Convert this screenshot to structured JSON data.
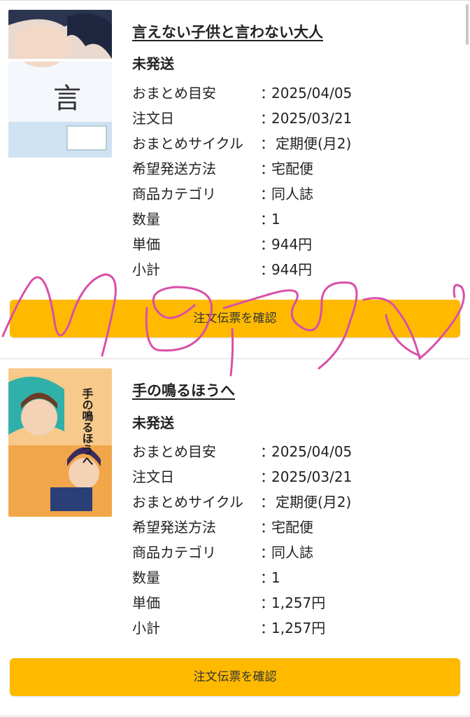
{
  "orders": [
    {
      "title": "言えない子供と言わない大人",
      "status": "未発送",
      "cover_text": "言",
      "rows": [
        {
          "label": "おまとめ目安",
          "colon": "：",
          "value": "2025/04/05"
        },
        {
          "label": "注文日",
          "colon": "：",
          "value": "2025/03/21"
        },
        {
          "label": "おまとめサイクル",
          "colon": "：",
          "value": "定期便(月2)"
        },
        {
          "label": "希望発送方法",
          "colon": "：",
          "value": "宅配便"
        },
        {
          "label": "商品カテゴリ",
          "colon": "：",
          "value": "同人誌"
        },
        {
          "label": "数量",
          "colon": "：",
          "value": "1"
        },
        {
          "label": "単価",
          "colon": "：",
          "value": "944円"
        },
        {
          "label": "小計",
          "colon": "：",
          "value": "944円"
        }
      ],
      "button_label": "注文伝票を確認"
    },
    {
      "title": "手の鳴るほうへ",
      "status": "未発送",
      "cover_text": "手の鳴るほうへ",
      "rows": [
        {
          "label": "おまとめ目安",
          "colon": "：",
          "value": "2025/04/05"
        },
        {
          "label": "注文日",
          "colon": "：",
          "value": "2025/03/21"
        },
        {
          "label": "おまとめサイクル",
          "colon": "：",
          "value": "定期便(月2)"
        },
        {
          "label": "希望発送方法",
          "colon": "：",
          "value": "宅配便"
        },
        {
          "label": "商品カテゴリ",
          "colon": "：",
          "value": "同人誌"
        },
        {
          "label": "数量",
          "colon": "：",
          "value": "1"
        },
        {
          "label": "単価",
          "colon": "：",
          "value": "1,257円"
        },
        {
          "label": "小計",
          "colon": "：",
          "value": "1,257円"
        }
      ],
      "button_label": "注文伝票を確認"
    }
  ],
  "colors": {
    "button": "#ffba00",
    "annotation_stroke": "#d94fa8"
  }
}
